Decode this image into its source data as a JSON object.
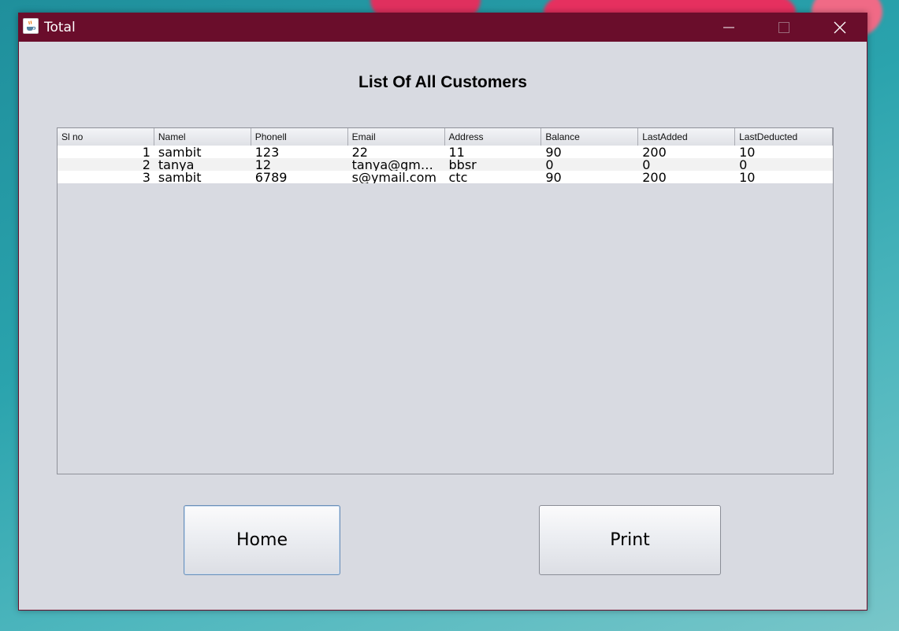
{
  "window": {
    "title": "Total",
    "titlebar_color": "#6a0d2b",
    "background_color": "#d8dae1"
  },
  "heading": "List Of All Customers",
  "table": {
    "columns": [
      "Sl no",
      "Namel",
      "Phonell",
      "Email",
      "Address",
      "Balance",
      "LastAdded",
      "LastDeducted"
    ],
    "rows": [
      [
        "1",
        "sambit",
        "123",
        "22",
        "11",
        "90",
        "200",
        "10"
      ],
      [
        "2",
        "tanya",
        "12",
        "tanya@gmai...",
        "bbsr",
        "0",
        "0",
        "0"
      ],
      [
        "3",
        "sambit",
        "6789",
        "s@ymail.com",
        "ctc",
        "90",
        "200",
        "10"
      ]
    ]
  },
  "buttons": {
    "home": "Home",
    "print": "Print"
  },
  "icons": {
    "app": "java-coffee-cup-icon",
    "minimize": "minimize-icon",
    "maximize": "maximize-icon",
    "close": "close-icon"
  }
}
